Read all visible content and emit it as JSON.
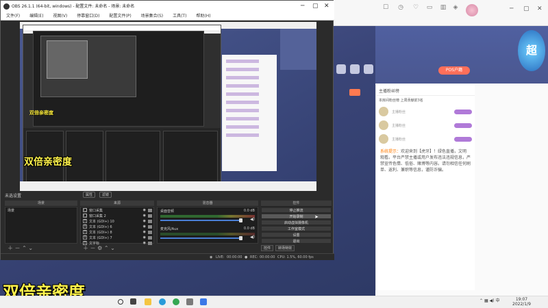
{
  "browser": {
    "top_icons": [
      {
        "label": "",
        "icon": "bell-icon"
      },
      {
        "label": "",
        "icon": "clock-icon"
      },
      {
        "label": "",
        "icon": "heart-icon"
      },
      {
        "label": "",
        "icon": "folder-icon"
      },
      {
        "label": "",
        "icon": "chart-icon"
      },
      {
        "label": "",
        "icon": "gift-icon"
      },
      {
        "label": "",
        "icon": "location-icon"
      }
    ],
    "pos_button": "POS户籍",
    "logo_text": "超"
  },
  "chat": {
    "header": "主播粉丝榜",
    "notice": "本房间粉丝榜 上周贡献前3名",
    "users": [
      {
        "name": "主播粉丝"
      },
      {
        "name": "主播粉丝"
      },
      {
        "name": "主播粉丝"
      }
    ],
    "message_prefix": "系统提示：",
    "message": "欢迎来到【虎牙】！绿色直播，文明观看。平台严禁主播或用户发布违法违规信息，严禁宣传色情、低俗、赌博等内容。请勿相信任何刷单、返利、兼职等信息，谨防诈骗。"
  },
  "obs": {
    "title": "OBS 26.1.1 (64-bit, windows) - 配置文件: 未命名 - 场景: 未命名",
    "menu": [
      "文件(F)",
      "编辑(E)",
      "视图(V)",
      "停靠窗口(D)",
      "配置文件(P)",
      "场景集合(S)",
      "工具(T)",
      "帮助(H)"
    ],
    "preview_overlay": "双倍亲密度",
    "no_source": "未选设置",
    "mini_buttons": [
      "属性",
      "滤镜"
    ],
    "docks": {
      "scenes": {
        "title": "场景",
        "items": [
          "场景"
        ]
      },
      "sources": {
        "title": "来源",
        "items": [
          {
            "glyph": "▢",
            "name": "窗口采集"
          },
          {
            "glyph": "▢",
            "name": "窗口采集 2"
          },
          {
            "glyph": "T",
            "name": "文本 (GDI+) 10"
          },
          {
            "glyph": "T",
            "name": "文本 (GDI+) 6"
          },
          {
            "glyph": "T",
            "name": "文本 (GDI+) 8"
          },
          {
            "glyph": "T",
            "name": "文本 (GDI+) 7"
          },
          {
            "glyph": "T",
            "name": "文字标"
          }
        ]
      },
      "mixer": {
        "title": "混音器",
        "channels": [
          {
            "name": "桌面音频",
            "level": "0.0 dB"
          },
          {
            "name": "麦克风/Aux",
            "level": "0.0 dB"
          }
        ]
      },
      "controls": {
        "title": "控件",
        "buttons": [
          "停止推流",
          "开始录制",
          "启动虚拟摄像机",
          "工作室模式",
          "设置",
          "退出"
        ]
      }
    },
    "control_tabs": [
      "控件",
      "转场特效"
    ],
    "status": {
      "live_label": "LIVE:",
      "live_time": "00:00:00",
      "rec_label": "REC:",
      "rec_time": "00:00:00",
      "cpu": "CPU: 1.5%, 60.00 fps"
    }
  },
  "overlay_big": "双倍亲密度",
  "taskbar": {
    "time": "19:07",
    "date": "2022/1/9"
  },
  "colors": {
    "accent_orange": "#ff6f5a",
    "obs_bg": "#2b2b2b",
    "overlay_yellow": "#fff34a",
    "meter_green": "#3fa43f"
  }
}
